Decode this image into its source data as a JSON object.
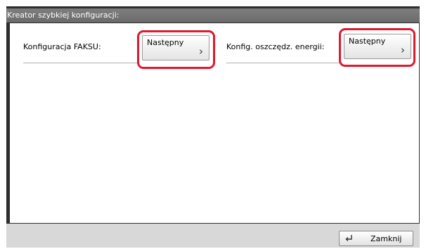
{
  "window": {
    "title": "Kreator szybkiej konfiguracji:"
  },
  "rows": [
    {
      "label": "Konfiguracja FAKSU:",
      "button_label": "Następny"
    },
    {
      "label": "Konfig. oszczędz. energii:",
      "button_label": "Następny"
    }
  ],
  "footer": {
    "close_label": "Zamknij"
  },
  "colors": {
    "highlight": "#e0182d",
    "titlebar": "#737373"
  }
}
